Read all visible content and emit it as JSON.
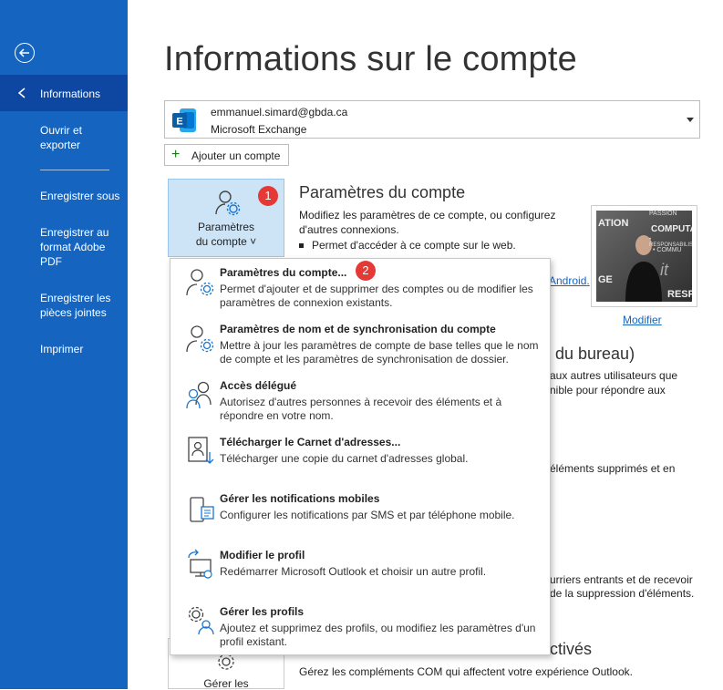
{
  "sidebar": {
    "items": [
      {
        "label": "Informations",
        "lines": [
          "Informations"
        ]
      },
      {
        "label": "Ouvrir et exporter",
        "lines": [
          "Ouvrir et",
          "exporter"
        ]
      },
      {
        "label": "Enregistrer sous",
        "lines": [
          "Enregistrer sous"
        ]
      },
      {
        "label": "Enregistrer au format Adobe PDF",
        "lines": [
          "Enregistrer au",
          "format Adobe",
          "PDF"
        ]
      },
      {
        "label": "Enregistrer les pièces jointes",
        "lines": [
          "Enregistrer les",
          "pièces jointes"
        ]
      },
      {
        "label": "Imprimer",
        "lines": [
          "Imprimer"
        ]
      }
    ]
  },
  "page": {
    "title": "Informations sur le compte"
  },
  "account": {
    "email": "emmanuel.simard@gbda.ca",
    "type": "Microsoft Exchange",
    "add_label": "Ajouter un compte"
  },
  "account_settings": {
    "button_line1": "Paramètres",
    "button_line2": "du compte ˅",
    "title": "Paramètres du compte",
    "desc": "Modifiez les paramètres de ce compte, ou configurez d'autres connexions.",
    "bullet": "Permet d'accéder à ce compte sur le web.",
    "android_link": "Android.",
    "photo_link": "Modifier",
    "photo_text": {
      "a": "ATION",
      "b": "PASSION",
      "c": "COMPUTAT",
      "d": "• RESPONSABILISATION",
      "e": "• COMMU",
      "f": "GE",
      "g": "RESP",
      "h": "it"
    }
  },
  "badges": {
    "one": "1",
    "two": "2"
  },
  "background": {
    "title2": "du bureau)",
    "t1a": "aux autres utilisateurs que",
    "t1b": "nible pour répondre aux",
    "t2": "éléments supprimés et en",
    "t3a": "urriers entrants et de recevoir",
    "t3b": "de la suppression d'éléments.",
    "title3": "ctivés",
    "t4": "Gérez les compléments COM qui affectent votre expérience Outlook.",
    "bottom_btn": "Gérer les"
  },
  "dropdown": {
    "items": [
      {
        "title": "Paramètres du compte...",
        "desc": "Permet d'ajouter et de supprimer des comptes ou de modifier les paramètres de connexion existants."
      },
      {
        "title": "Paramètres de nom et de synchronisation du compte",
        "desc": "Mettre à jour les paramètres de compte de base telles que le nom de compte et les paramètres de synchronisation de dossier."
      },
      {
        "title": "Accès délégué",
        "desc": "Autorisez d'autres personnes à recevoir des éléments et à répondre en votre nom."
      },
      {
        "title": "Télécharger le Carnet d'adresses...",
        "desc": "Télécharger une copie du carnet d'adresses global."
      },
      {
        "title": "Gérer les notifications mobiles",
        "desc": "Configurer les notifications par SMS et par téléphone mobile."
      },
      {
        "title": "Modifier le profil",
        "desc": "Redémarrer Microsoft Outlook et choisir un autre profil."
      },
      {
        "title": "Gérer les profils",
        "desc": "Ajoutez et supprimez des profils, ou modifiez les paramètres d'un profil existant."
      }
    ]
  },
  "colors": {
    "sidebar": "#1565c0",
    "sidebar_active": "#0d47a1",
    "accent": "#1565c0",
    "badge": "#e53935"
  }
}
